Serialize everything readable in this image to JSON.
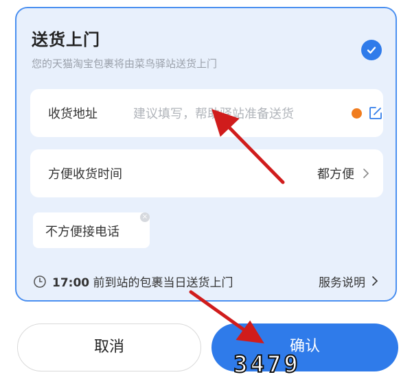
{
  "card": {
    "title": "送货上门",
    "subtitle": "您的天猫淘宝包裹将由菜鸟驿站送货上门",
    "selected": true
  },
  "address": {
    "label": "收货地址",
    "placeholder": "建议填写，帮助驿站准备送货"
  },
  "time": {
    "label": "方便收货时间",
    "value": "都方便"
  },
  "chip": {
    "label": "不方便接电话"
  },
  "footer": {
    "time": "17:00",
    "text": "前到站的包裹当日送货上门",
    "link": "服务说明"
  },
  "actions": {
    "cancel": "取消",
    "confirm": "确认"
  },
  "watermark": "3479",
  "colors": {
    "accent": "#2f7bea",
    "card_bg": "#e8f0fc",
    "dot": "#f07c1e",
    "arrow": "#d01c1c"
  }
}
